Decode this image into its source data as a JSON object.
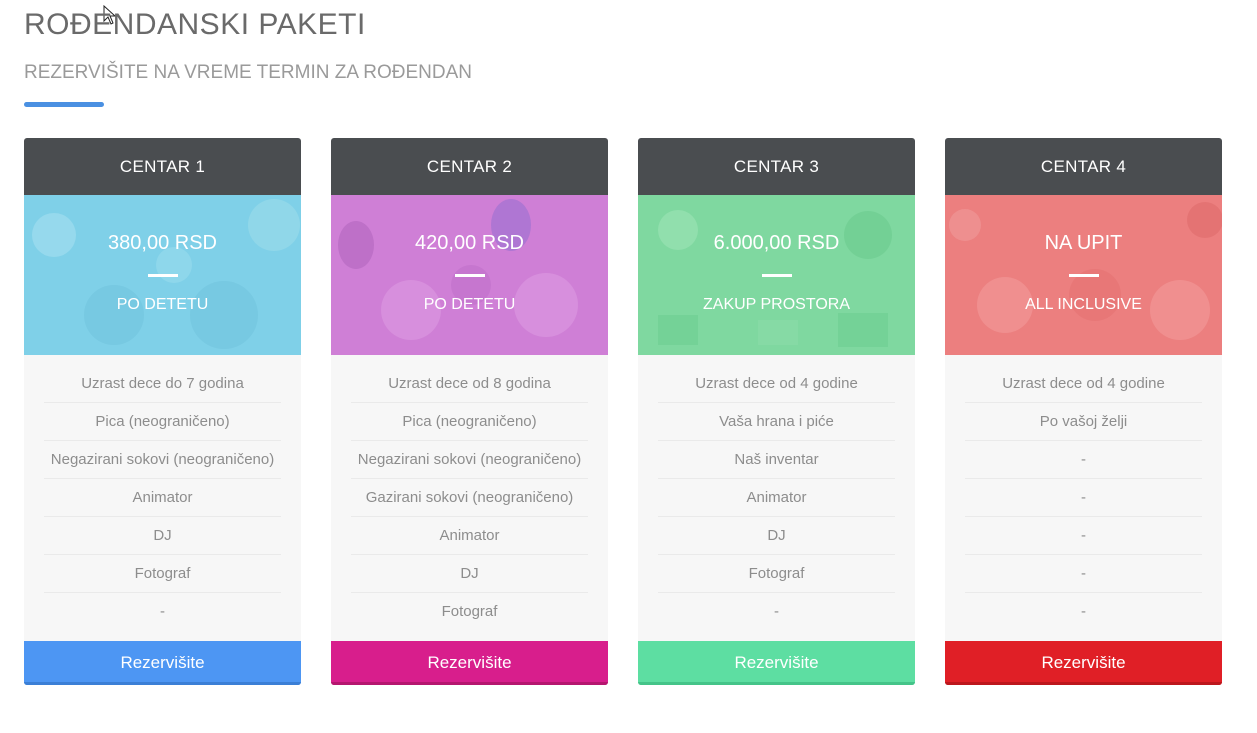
{
  "header": {
    "title": "ROĐENDANSKI PAKETI",
    "subtitle": "REZERVIŠITE NA VREME TERMIN ZA ROĐENDAN",
    "accent_color": "#4a90e2"
  },
  "cards": [
    {
      "name": "CENTAR 1",
      "price": "380,00 RSD",
      "unit": "PO DETETU",
      "overlay_color": "#7fd0e8",
      "features": [
        "Uzrast dece do 7 godina",
        "Pica (neograničeno)",
        "Negazirani sokovi (neograničeno)",
        "Animator",
        "DJ",
        "Fotograf",
        "-"
      ],
      "button": "Rezervišite",
      "button_color": "#4d96f3"
    },
    {
      "name": "CENTAR 2",
      "price": "420,00 RSD",
      "unit": "PO DETETU",
      "overlay_color": "#cf7fd6",
      "features": [
        "Uzrast dece od 8 godina",
        "Pica (neograničeno)",
        "Negazirani sokovi (neograničeno)",
        "Gazirani sokovi (neograničeno)",
        "Animator",
        "DJ",
        "Fotograf"
      ],
      "button": "Rezervišite",
      "button_color": "#d81e8c"
    },
    {
      "name": "CENTAR 3",
      "price": "6.000,00 RSD",
      "unit": "ZAKUP PROSTORA",
      "overlay_color": "#7fd8a0",
      "features": [
        "Uzrast dece od 4 godine",
        "Vaša hrana i piće",
        "Naš inventar",
        "Animator",
        "DJ",
        "Fotograf",
        "-"
      ],
      "button": "Rezervišite",
      "button_color": "#5ddea2"
    },
    {
      "name": "CENTAR 4",
      "price": "NA UPIT",
      "unit": "ALL INCLUSIVE",
      "overlay_color": "#ec7f7f",
      "features": [
        "Uzrast dece od 4 godine",
        "Po vašoj želji",
        "-",
        "-",
        "-",
        "-",
        "-"
      ],
      "button": "Rezervišite",
      "button_color": "#e01f26"
    }
  ]
}
